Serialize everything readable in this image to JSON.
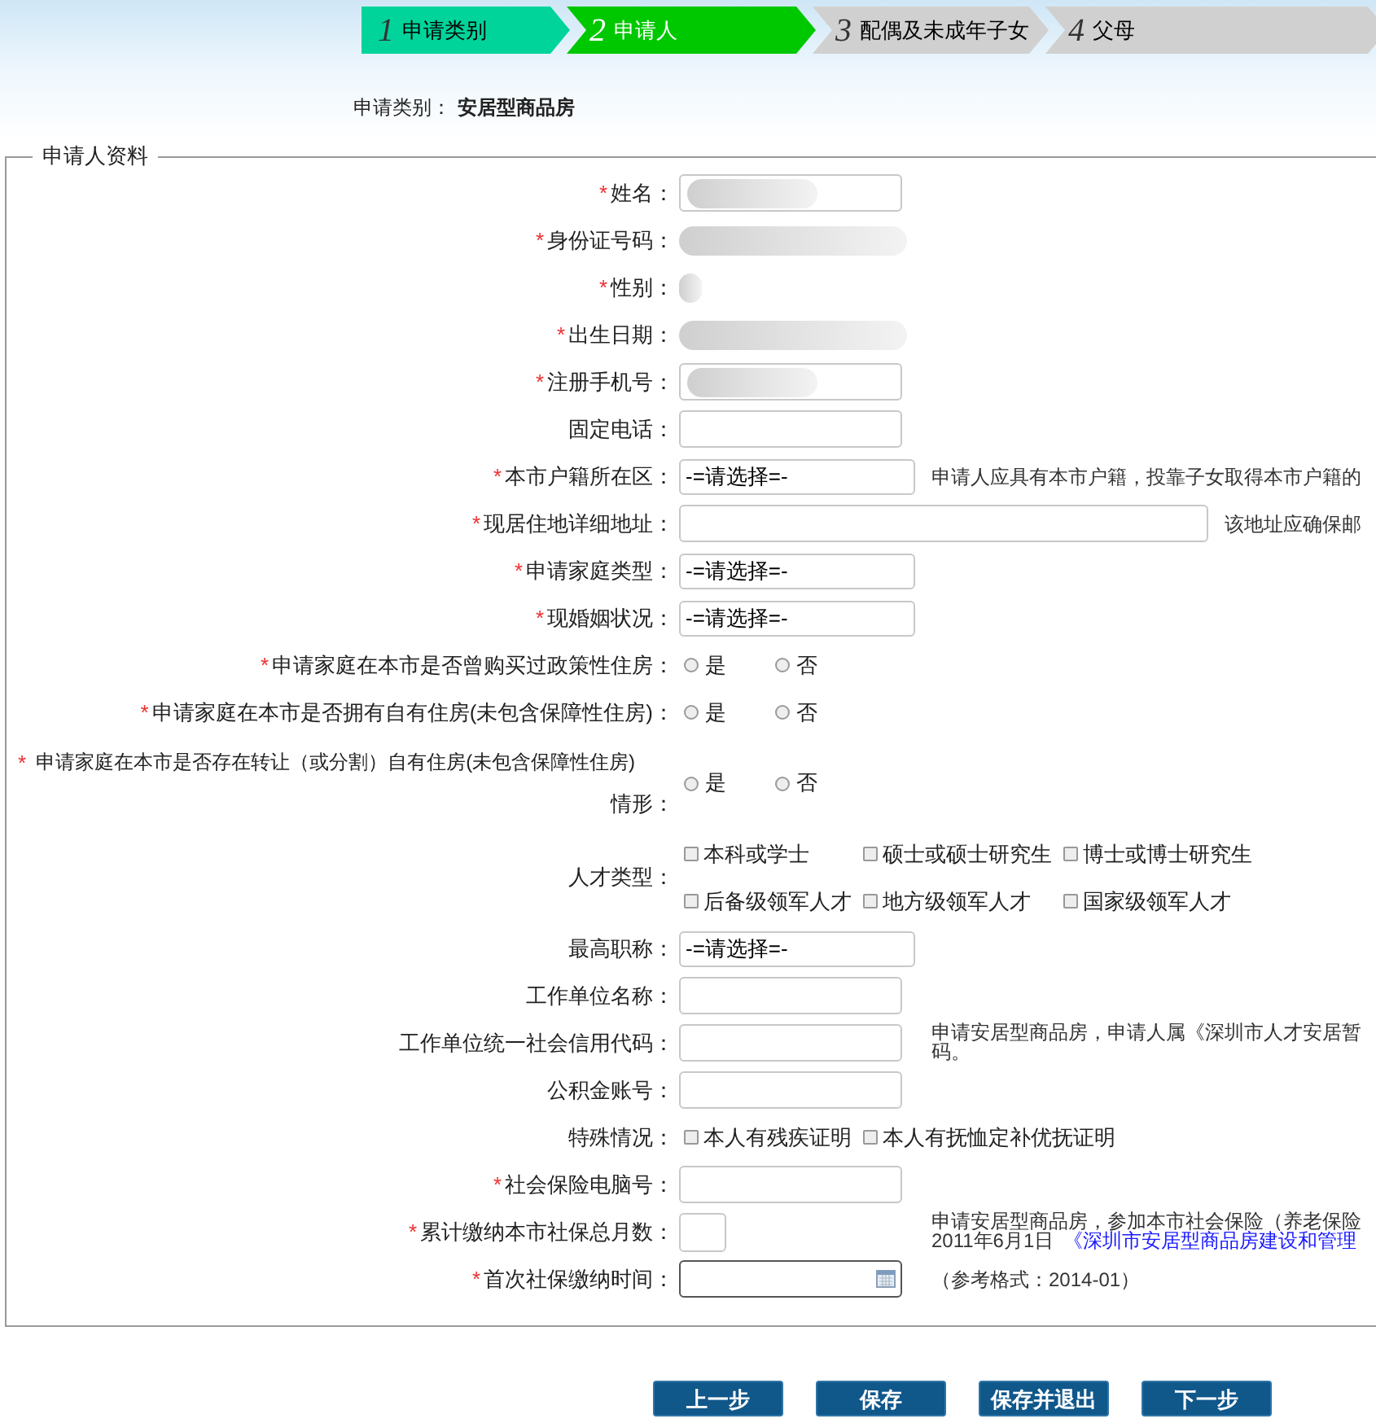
{
  "steps": [
    {
      "number": "1",
      "label": "申请类别",
      "selected": false,
      "done": true
    },
    {
      "number": "2",
      "label": "申请人",
      "selected": true,
      "done": false
    },
    {
      "number": "3",
      "label": "配偶及未成年子女",
      "selected": false,
      "done": false
    },
    {
      "number": "4",
      "label": "父母",
      "selected": false,
      "done": false
    }
  ],
  "category": {
    "label": "申请类别：",
    "value": "安居型商品房"
  },
  "section": {
    "title": "申请人资料"
  },
  "rows": [
    {
      "kind": "blurred_input",
      "label": "姓名：",
      "asterisk": "*"
    },
    {
      "kind": "blurred_text",
      "label": "身份证号码：",
      "asterisk": "*"
    },
    {
      "kind": "blurred_short",
      "label": "性别：",
      "asterisk": "*"
    },
    {
      "kind": "blurred_text",
      "label": "出生日期：",
      "asterisk": "*"
    },
    {
      "kind": "blurred_input",
      "label": "注册手机号：",
      "asterisk": "*"
    },
    {
      "kind": "text",
      "label": "固定电话："
    },
    {
      "kind": "select",
      "label": "本市户籍所在区：",
      "asterisk": "*",
      "value": "-=请选择=-",
      "hint_lines": [
        [
          {
            "text": "申请人应具有本市户籍，投靠子女取得本市户籍的",
            "link": false
          }
        ]
      ]
    },
    {
      "kind": "wide_text",
      "label": "现居住地详细地址：",
      "asterisk": "*",
      "hint_lines": [
        [
          {
            "text": "该地址应确保邮",
            "link": false
          }
        ]
      ]
    },
    {
      "kind": "select",
      "label": "申请家庭类型：",
      "asterisk": "*",
      "value": "-=请选择=-"
    },
    {
      "kind": "select",
      "label": "现婚姻状况：",
      "asterisk": "*",
      "value": "-=请选择=-"
    },
    {
      "kind": "radio",
      "label": "申请家庭在本市是否曾购买过政策性住房：",
      "asterisk": "*",
      "options": [
        {
          "label": "是",
          "selected": false
        },
        {
          "label": "否",
          "selected": false
        }
      ]
    },
    {
      "kind": "radio",
      "label": "申请家庭在本市是否拥有自有住房(未包含保障性住房)：",
      "asterisk": "*",
      "options": [
        {
          "label": "是",
          "selected": false
        },
        {
          "label": "否",
          "selected": false
        }
      ]
    },
    {
      "kind": "radio_tall",
      "label": "申请家庭在本市是否存在转让（或分割）自有住房(未包含保障性住房)",
      "label_line2": "情形：",
      "asterisk": "*",
      "options": [
        {
          "label": "是",
          "selected": false
        },
        {
          "label": "否",
          "selected": false
        }
      ]
    },
    {
      "kind": "checkbox_grid",
      "label": "人才类型：",
      "options": [
        {
          "label": "本科或学士",
          "checked": false
        },
        {
          "label": "硕士或硕士研究生",
          "checked": false
        },
        {
          "label": "博士或博士研究生",
          "checked": false
        },
        {
          "label": "后备级领军人才",
          "checked": false
        },
        {
          "label": "地方级领军人才",
          "checked": false
        },
        {
          "label": "国家级领军人才",
          "checked": false
        }
      ]
    },
    {
      "kind": "select",
      "label": "最高职称：",
      "value": "-=请选择=-"
    },
    {
      "kind": "text",
      "label": "工作单位名称："
    },
    {
      "kind": "text",
      "label": "工作单位统一社会信用代码：",
      "hint_lines": [
        [
          {
            "text": "申请安居型商品房，申请人属《深圳市人才安居暂",
            "link": false
          }
        ],
        [
          {
            "text": "码。",
            "link": false
          }
        ]
      ]
    },
    {
      "kind": "text",
      "label": "公积金账号："
    },
    {
      "kind": "checkbox",
      "label": "特殊情况：",
      "options": [
        {
          "label": "本人有残疾证明",
          "checked": false
        },
        {
          "label": "本人有抚恤定补优抚证明",
          "checked": false
        }
      ]
    },
    {
      "kind": "text",
      "label": "社会保险电脑号：",
      "asterisk": "*"
    },
    {
      "kind": "short_text",
      "label": "累计缴纳本市社保总月数：",
      "asterisk": "*",
      "hint_lines": [
        [
          {
            "text": "申请安居型商品房，参加本市社会保险（养老保险",
            "link": false
          }
        ],
        [
          {
            "text": "2011年6月1日",
            "link": false
          },
          {
            "text": "《深圳市安居型商品房建设和管理",
            "link": true
          }
        ]
      ]
    },
    {
      "kind": "date",
      "label": "首次社保缴纳时间：",
      "asterisk": "*",
      "hint_lines": [
        [
          {
            "text": "（参考格式：2014-01）",
            "link": false
          }
        ]
      ]
    }
  ],
  "buttons": [
    "上一步",
    "保存",
    "保存并退出",
    "下一步"
  ]
}
